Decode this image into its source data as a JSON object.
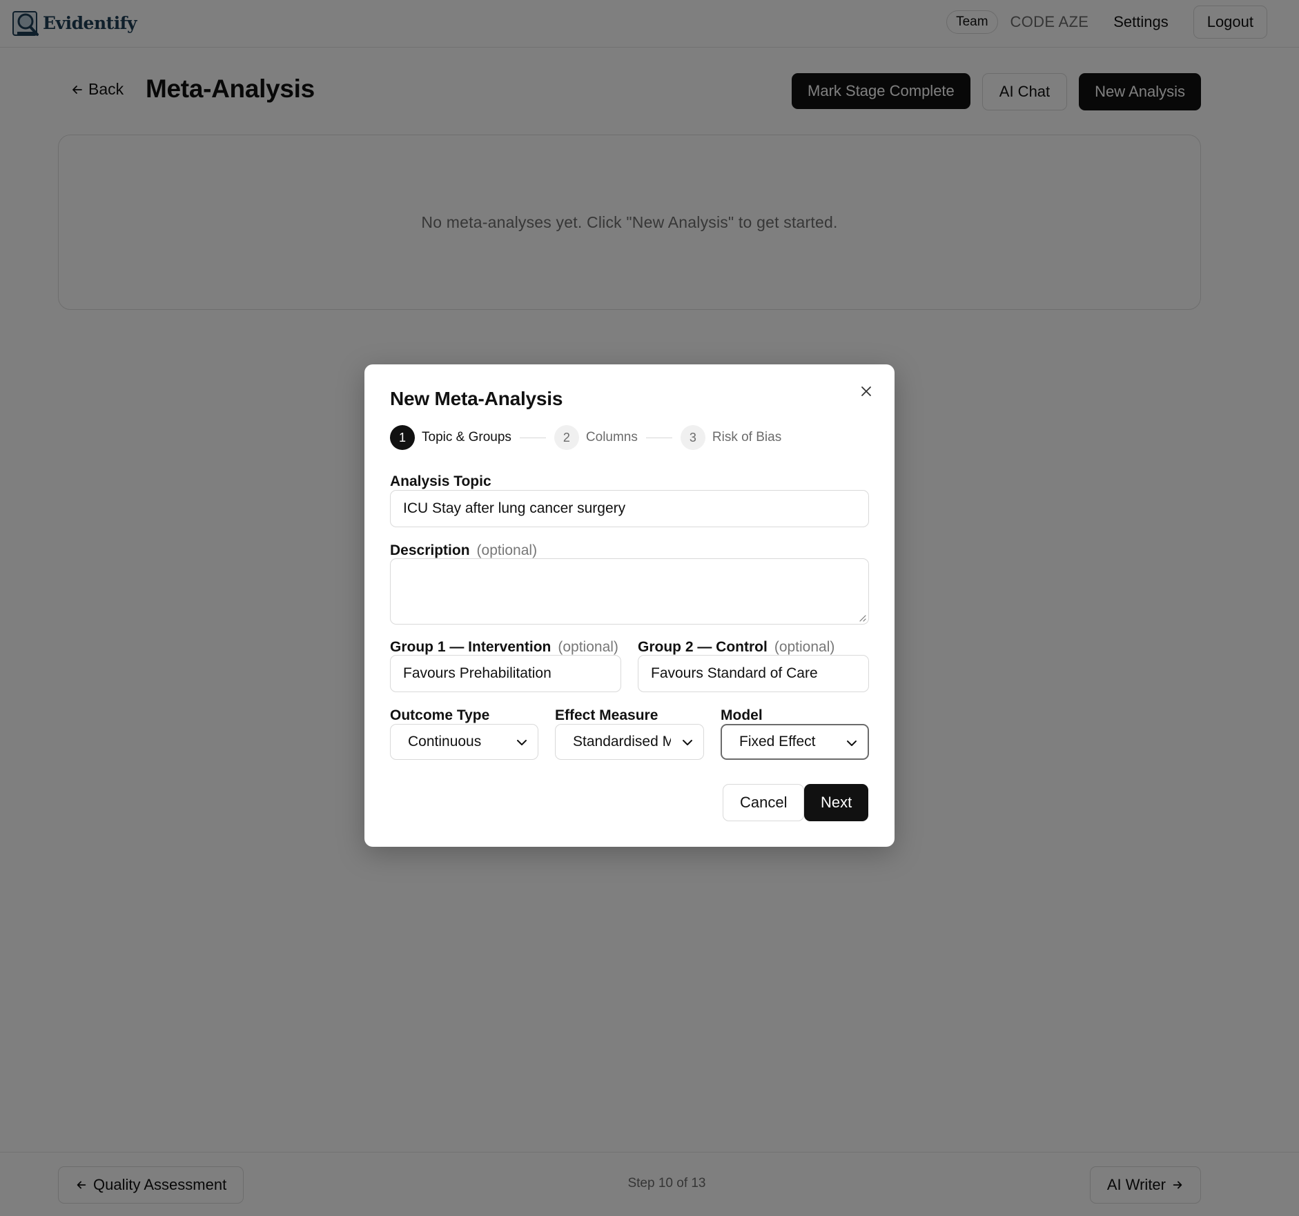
{
  "app": {
    "name": "Evidentify"
  },
  "nav": {
    "team_badge": "Team",
    "team_name": "CODE AZE",
    "settings": "Settings",
    "logout": "Logout"
  },
  "header": {
    "back": "Back",
    "title": "Meta-Analysis",
    "mark_complete": "Mark Stage Complete",
    "ai_chat": "AI Chat",
    "new_analysis": "New Analysis"
  },
  "empty_state": "No meta-analyses yet. Click \"New Analysis\" to get started.",
  "footer": {
    "prev": "Quality Assessment",
    "step": "Step 10 of 13",
    "next": "AI Writer"
  },
  "modal": {
    "title": "New Meta-Analysis",
    "steps": [
      {
        "num": "1",
        "label": "Topic & Groups",
        "active": true
      },
      {
        "num": "2",
        "label": "Columns",
        "active": false
      },
      {
        "num": "3",
        "label": "Risk of Bias",
        "active": false
      }
    ],
    "topic": {
      "label": "Analysis Topic",
      "value": "ICU Stay after lung cancer surgery"
    },
    "description": {
      "label": "Description",
      "optional": "(optional)",
      "value": ""
    },
    "group1": {
      "label": "Group 1 — Intervention",
      "optional": "(optional)",
      "value": "Favours Prehabilitation"
    },
    "group2": {
      "label": "Group 2 — Control",
      "optional": "(optional)",
      "value": "Favours Standard of Care"
    },
    "outcome_type": {
      "label": "Outcome Type",
      "value": "Continuous"
    },
    "effect_measure": {
      "label": "Effect Measure",
      "value": "Standardised Mean Difference"
    },
    "model": {
      "label": "Model",
      "value": "Fixed Effect"
    },
    "cancel": "Cancel",
    "next": "Next"
  },
  "icons": [
    "logo-icon",
    "arrow-left-icon",
    "arrow-right-icon",
    "close-icon",
    "chevron-down-icon",
    "resize-grip-icon"
  ]
}
